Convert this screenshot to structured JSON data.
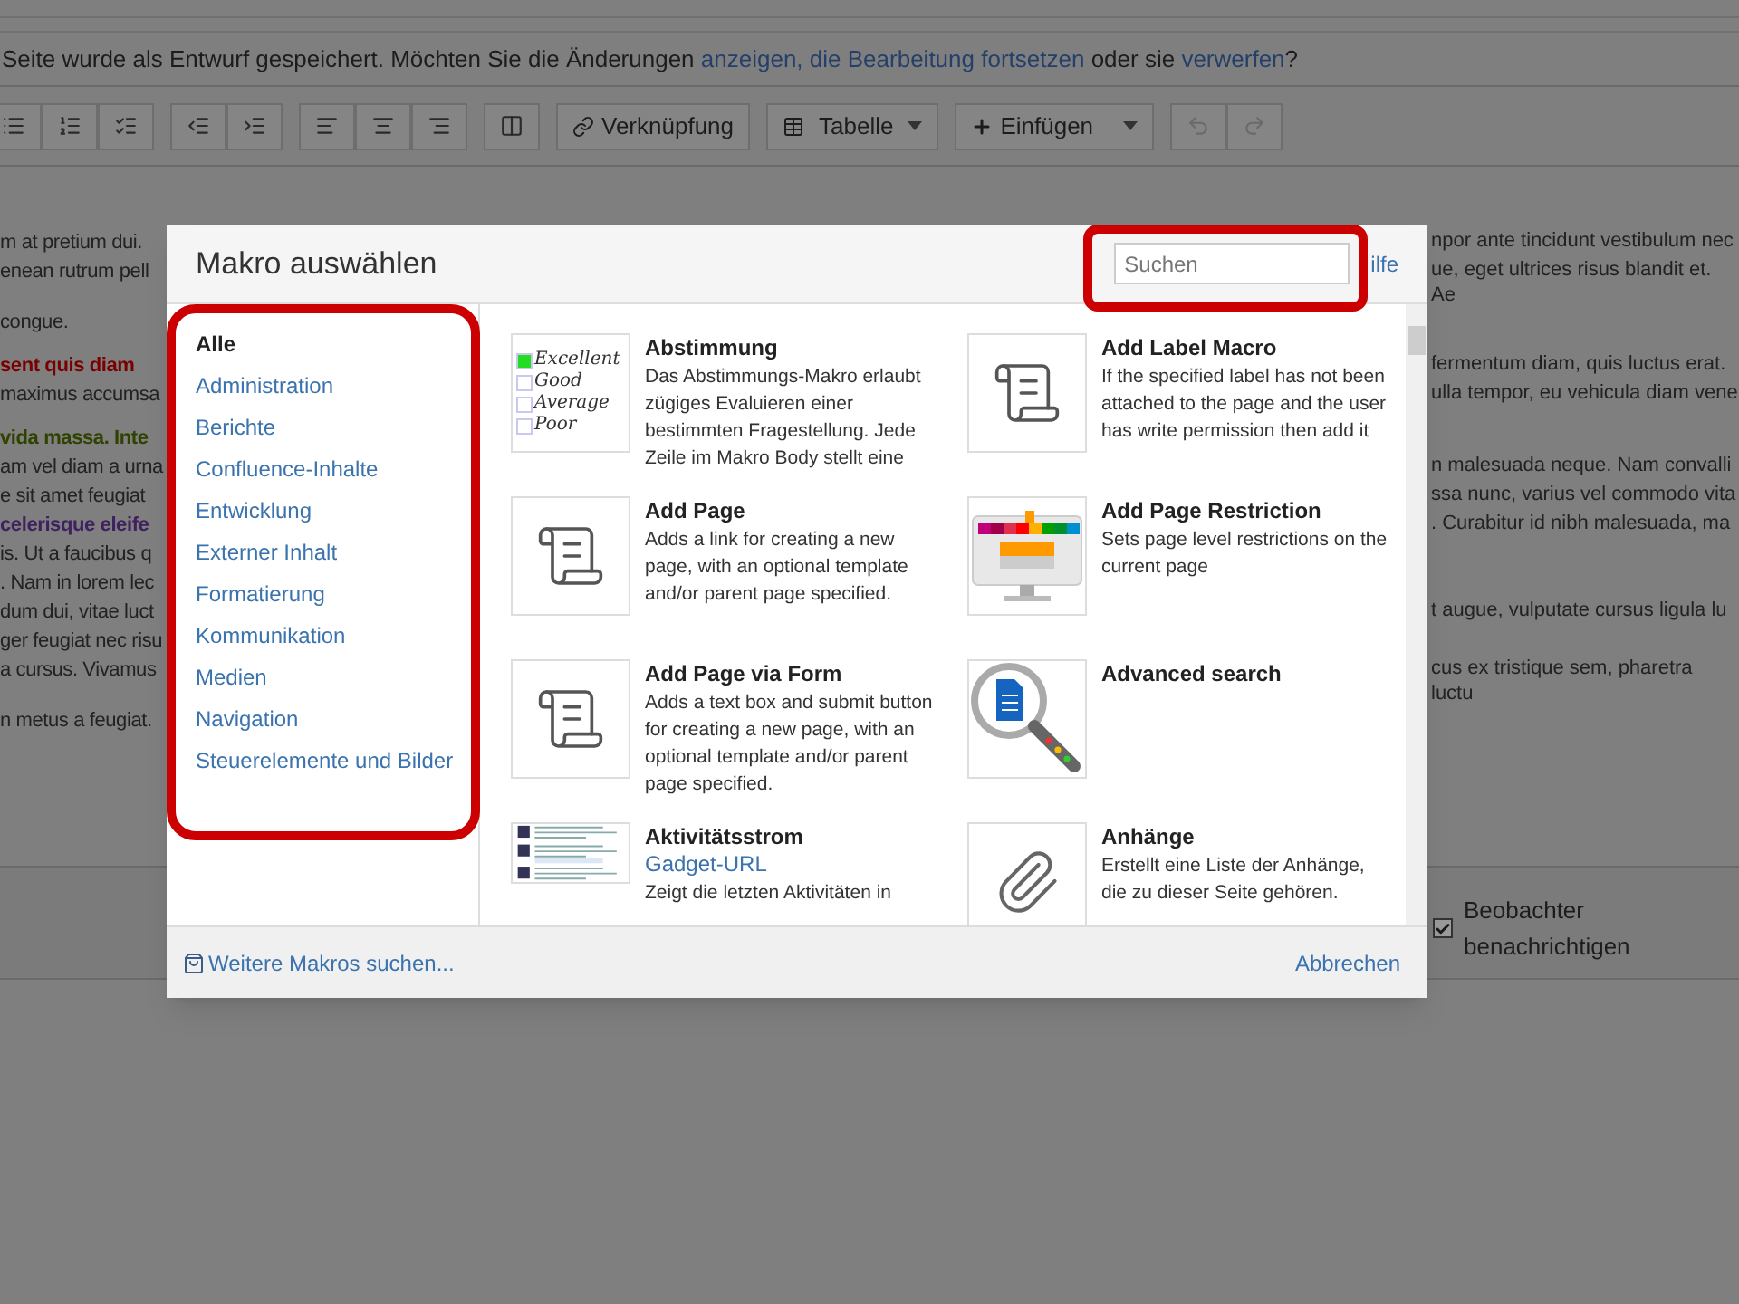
{
  "draft_notice": {
    "text": "Seite wurde als Entwurf gespeichert. Möchten Sie die Änderungen ",
    "links": [
      "anzeigen,",
      "die Bearbeitung fortsetzen"
    ],
    "middle": "oder sie",
    "last_link": "verwerfen",
    "end": "?"
  },
  "toolbar": {
    "link_button": "Verknüpfung",
    "table_button": "Tabelle",
    "insert_button": "Einfügen",
    "undo_disabled": true,
    "redo_disabled": true
  },
  "background_paragraphs": [
    {
      "lines": [
        {
          "left": "m at pretium dui.",
          "right": "npor ante tincidunt vestibulum nec"
        },
        {
          "left": "enean rutrum pell",
          "right": "ue, eget ultrices risus blandit et. Ae"
        },
        {
          "left": "congue."
        }
      ]
    },
    {
      "lines": [
        {
          "left": "sent quis diam",
          "color": "#7a0000",
          "right": "fermentum diam, quis luctus erat."
        },
        {
          "left": "maximus accumsa",
          "right": "ulla tempor, eu vehicula diam vene"
        }
      ]
    },
    {
      "lines": [
        {
          "left": "vida massa. Inte",
          "color": "#2f4200"
        },
        {
          "left": "am vel diam a urna",
          "right": "n malesuada neque. Nam convalli"
        },
        {
          "left": "e sit amet feugiat",
          "right": "ssa nunc, varius vel commodo vita"
        },
        {
          "left": "celerisque eleife",
          "color": "#3f2160",
          "right": ". Curabitur id nibh malesuada, ma"
        },
        {
          "left": "is. Ut a faucibus q"
        },
        {
          "left": ". Nam in lorem lec"
        },
        {
          "left": "dum dui, vitae luct",
          "right": "t augue, vulputate cursus ligula lu"
        },
        {
          "left": "ger feugiat nec risu"
        },
        {
          "left": "a cursus. Vivamus",
          "right": "cus ex tristique sem, pharetra luctu"
        },
        {
          "left": "n metus a feugiat."
        }
      ]
    }
  ],
  "notify": {
    "label": "Beobachter benachrichtigen",
    "checked": true
  },
  "dialog": {
    "title": "Makro auswählen",
    "search_placeholder": "Suchen",
    "help_link": "ilfe",
    "categories": [
      {
        "label": "Alle",
        "selected": true
      },
      {
        "label": "Administration",
        "selected": false
      },
      {
        "label": "Berichte",
        "selected": false
      },
      {
        "label": "Confluence-Inhalte",
        "selected": false
      },
      {
        "label": "Entwicklung",
        "selected": false
      },
      {
        "label": "Externer Inhalt",
        "selected": false
      },
      {
        "label": "Formatierung",
        "selected": false
      },
      {
        "label": "Kommunikation",
        "selected": false
      },
      {
        "label": "Medien",
        "selected": false
      },
      {
        "label": "Navigation",
        "selected": false
      },
      {
        "label": "Steuerelemente und Bilder",
        "selected": false
      }
    ],
    "macros": [
      {
        "title": "Abstimmung",
        "kind": "poll",
        "poll_options": [
          "Excellent",
          "Good",
          "Average",
          "Poor"
        ],
        "description": "Das Abstimmungs-Makro erlaubt zügiges Evaluieren einer bestimmten Fragestellung. Jede Zeile im Makro Body stellt eine"
      },
      {
        "title": "Add Label Macro",
        "kind": "scroll",
        "description": "If the specified label has not been attached to the page and the user has write permission then add it"
      },
      {
        "title": "Add Page",
        "kind": "scroll",
        "description": "Adds a link for creating a new page, with an optional template and/or parent page specified."
      },
      {
        "title": "Add Page Restriction",
        "kind": "restriction",
        "description": "Sets page level restrictions on the current page"
      },
      {
        "title": "Add Page via Form",
        "kind": "scroll",
        "description": "Adds a text box and submit button for creating a new page, with an optional template and/or parent page specified."
      },
      {
        "title": "Advanced search",
        "kind": "search"
      },
      {
        "title": "Aktivitätsstrom",
        "kind": "activity",
        "subtitle": "Gadget-URL",
        "description": "Zeigt die letzten Aktivitäten in"
      },
      {
        "title": "Anhänge",
        "kind": "paperclip",
        "description": "Erstellt eine Liste der Anhänge, die zu dieser Seite gehören."
      }
    ],
    "more_link": "Weitere Makros suchen...",
    "cancel": "Abbrechen"
  }
}
